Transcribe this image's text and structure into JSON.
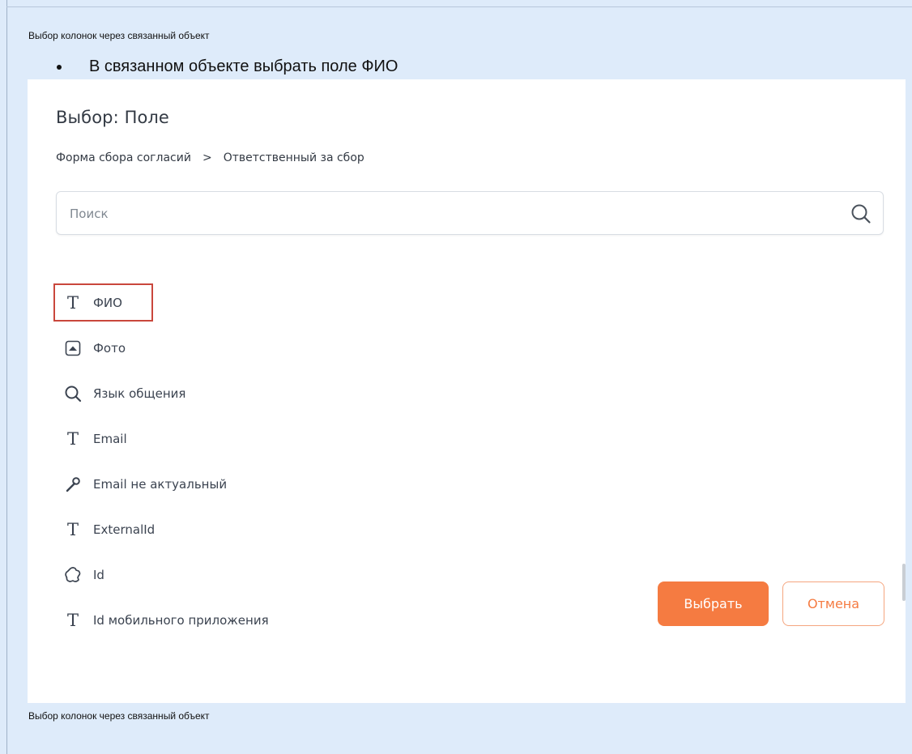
{
  "doc": {
    "caption_top": "Выбор колонок через связанный объект",
    "bullet_text": "В связанном объекте выбрать поле ФИО",
    "caption_bottom": "Выбор колонок через связанный объект"
  },
  "dialog": {
    "title": "Выбор: Поле",
    "breadcrumb": {
      "parent": "Форма сбора согласий",
      "separator": ">",
      "current": "Ответственный за сбор"
    },
    "search": {
      "placeholder": "Поиск",
      "value": ""
    },
    "fields": [
      {
        "label": "ФИО",
        "icon": "text-type-icon",
        "highlighted": true
      },
      {
        "label": "Фото",
        "icon": "image-icon"
      },
      {
        "label": "Язык общения",
        "icon": "lookup-search-icon"
      },
      {
        "label": "Email",
        "icon": "text-type-icon"
      },
      {
        "label": "Email не актуальный",
        "icon": "boolean-icon"
      },
      {
        "label": "ExternalId",
        "icon": "text-type-icon"
      },
      {
        "label": "Id",
        "icon": "unique-id-icon"
      },
      {
        "label": "Id мобильного приложения",
        "icon": "text-type-icon"
      }
    ],
    "buttons": {
      "select": "Выбрать",
      "cancel": "Отмена"
    }
  },
  "colors": {
    "page_bg": "#deebfa",
    "accent": "#f57b41",
    "highlight": "#c9473c"
  }
}
